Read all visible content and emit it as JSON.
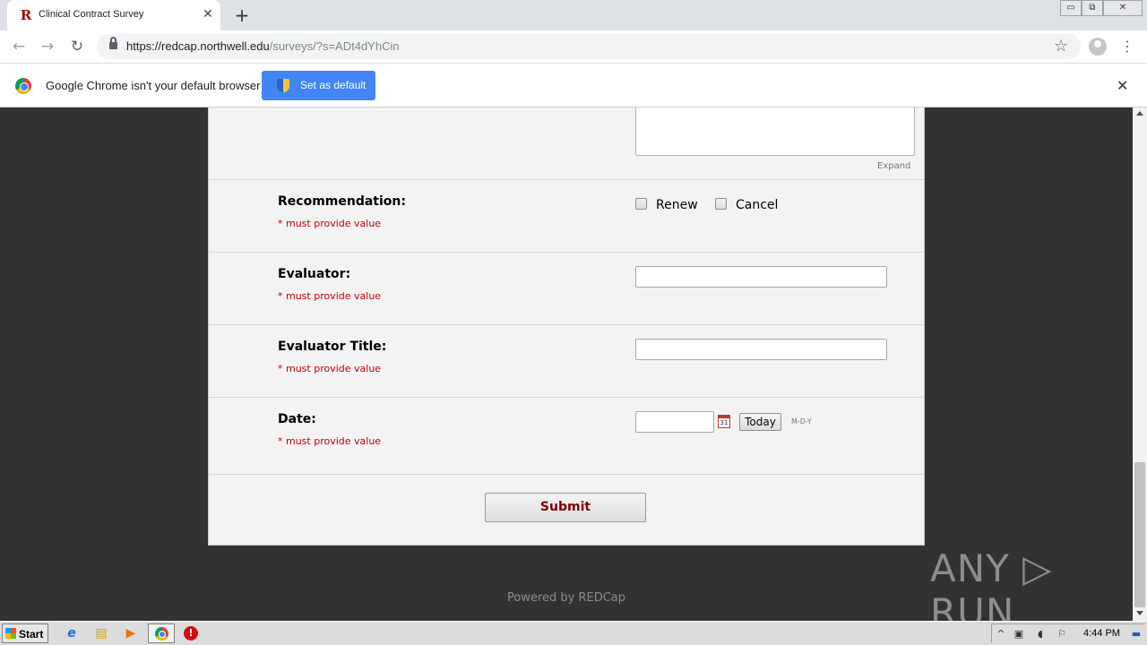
{
  "browser": {
    "tab_title": "Clinical Contract Survey",
    "tab_close": "✕",
    "new_tab": "+",
    "url_host": "https://redcap.northwell.edu",
    "url_path": "/surveys/?s=ADt4dYhCin",
    "back": "←",
    "forward": "→",
    "reload": "↻",
    "star": "☆",
    "menu": "⋮",
    "win_min": "▭",
    "win_restore": "⧉",
    "win_close": "✕"
  },
  "infobar": {
    "message": "Google Chrome isn't your default browser",
    "button_label": "Set as default",
    "close": "✕"
  },
  "form": {
    "expand_label": "Expand",
    "fields": [
      {
        "label": "Recommendation:",
        "required_note": "* must provide value",
        "options": [
          "Renew",
          "Cancel"
        ]
      },
      {
        "label": "Evaluator:",
        "required_note": "* must provide value"
      },
      {
        "label": "Evaluator Title:",
        "required_note": "* must provide value"
      },
      {
        "label": "Date:",
        "required_note": "* must provide value",
        "today_label": "Today",
        "format": "M-D-Y",
        "calendar_day": "31"
      }
    ],
    "submit_label": "Submit"
  },
  "footer": {
    "powered_by": "Powered by REDCap",
    "watermark": "ANY ▷ RUN"
  },
  "taskbar": {
    "start_label": "Start",
    "clock": "4:44 PM"
  },
  "icons": {
    "tab_favicon": "R",
    "ie": "e",
    "explorer": "▤",
    "media": "▶",
    "stop": "!",
    "tray_up": "^",
    "tray_network": "▣",
    "tray_volume": "◖",
    "tray_flag": "⚐",
    "tray_screen": "▬"
  }
}
